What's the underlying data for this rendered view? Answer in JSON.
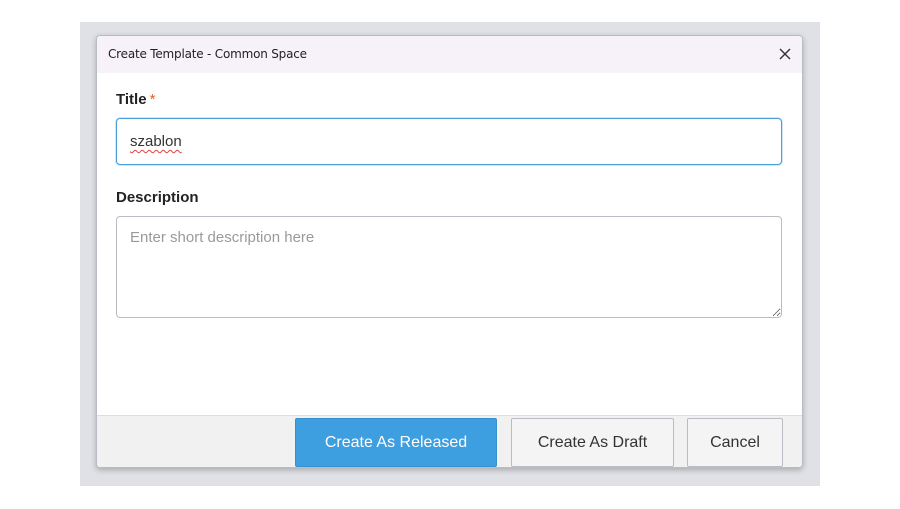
{
  "dialog": {
    "title": "Create Template - Common Space",
    "close_icon": "close-icon"
  },
  "form": {
    "title_label": "Title",
    "required_marker": "*",
    "title_value": "szablon",
    "description_label": "Description",
    "description_placeholder": "Enter short description here",
    "description_value": ""
  },
  "footer": {
    "create_released_label": "Create As Released",
    "create_draft_label": "Create As Draft",
    "cancel_label": "Cancel"
  },
  "colors": {
    "primary": "#3d9ee0",
    "focus_border": "#4a9fd8",
    "required": "#e0641f"
  }
}
